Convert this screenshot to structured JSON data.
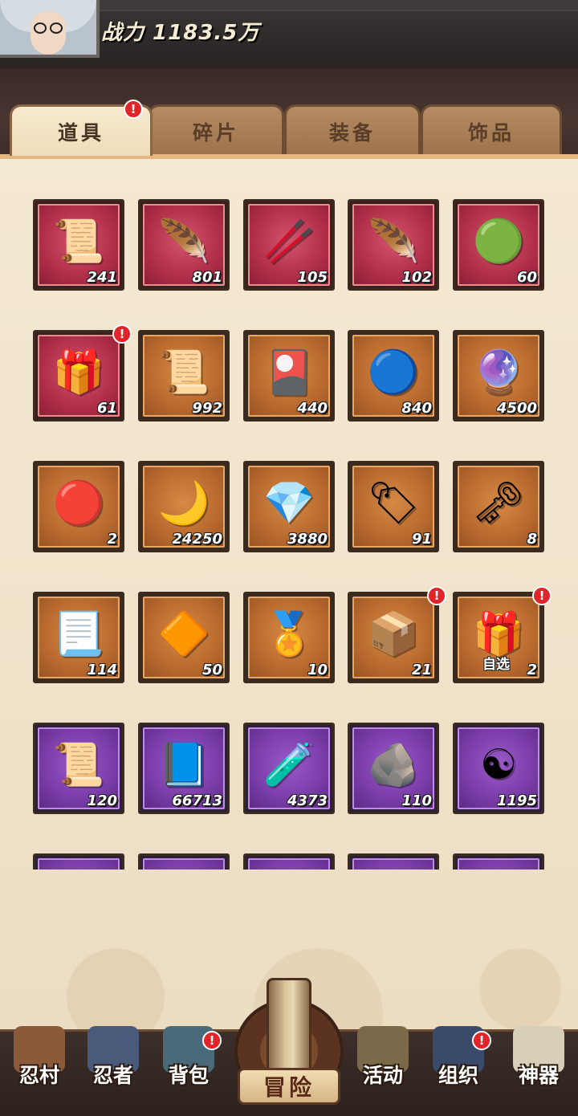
{
  "header": {
    "power_label": "战力 1183.5万",
    "avatar": "silver-haired-ninja-glasses"
  },
  "tabs": [
    {
      "label": "道具",
      "active": true,
      "badge": "!"
    },
    {
      "label": "碎片",
      "active": false
    },
    {
      "label": "装备",
      "active": false
    },
    {
      "label": "饰品",
      "active": false
    }
  ],
  "items": [
    {
      "icon": "scroll-bundle-icon",
      "glyph": "📜",
      "count": "241",
      "rarity": "red"
    },
    {
      "icon": "red-feather-icon",
      "glyph": "🪶",
      "count": "801",
      "rarity": "red"
    },
    {
      "icon": "wooden-stick-icon",
      "glyph": "🥢",
      "count": "105",
      "rarity": "red"
    },
    {
      "icon": "gold-feather-icon",
      "glyph": "🪶",
      "count": "102",
      "rarity": "red"
    },
    {
      "icon": "jade-pendant-icon",
      "glyph": "🟢",
      "count": "60",
      "rarity": "red"
    },
    {
      "icon": "gift-box-icon",
      "glyph": "🎁",
      "count": "61",
      "rarity": "red",
      "badge": "!"
    },
    {
      "icon": "parchment-scroll-icon",
      "glyph": "📜",
      "count": "992",
      "rarity": "brown"
    },
    {
      "icon": "ticket-card-icon",
      "glyph": "🎴",
      "count": "440",
      "rarity": "brown"
    },
    {
      "icon": "blue-orb-icon",
      "glyph": "🔵",
      "count": "840",
      "rarity": "brown"
    },
    {
      "icon": "purple-orb-icon",
      "glyph": "🔮",
      "count": "4500",
      "rarity": "brown"
    },
    {
      "icon": "red-eye-stone-icon",
      "glyph": "🔴",
      "count": "2",
      "rarity": "brown"
    },
    {
      "icon": "blue-moon-icon",
      "glyph": "🌙",
      "count": "24250",
      "rarity": "brown"
    },
    {
      "icon": "purple-crystal-icon",
      "glyph": "💎",
      "count": "3880",
      "rarity": "brown"
    },
    {
      "icon": "fortune-sign-icon",
      "glyph": "🏷",
      "count": "91",
      "rarity": "brown"
    },
    {
      "icon": "iron-key-icon",
      "glyph": "🗝",
      "count": "8",
      "rarity": "brown"
    },
    {
      "icon": "paper-talisman-icon",
      "glyph": "📃",
      "count": "114",
      "rarity": "brown"
    },
    {
      "icon": "amber-gem-icon",
      "glyph": "🔶",
      "count": "50",
      "rarity": "brown"
    },
    {
      "icon": "wisdom-medal-icon",
      "glyph": "🏅",
      "count": "10",
      "rarity": "brown"
    },
    {
      "icon": "gold-chest-icon",
      "glyph": "📦",
      "count": "21",
      "rarity": "brown",
      "badge": "!"
    },
    {
      "icon": "select-chest-icon",
      "glyph": "🎁",
      "count": "2",
      "rarity": "brown",
      "badge": "!",
      "tag": "自选"
    },
    {
      "icon": "blue-scroll-icon",
      "glyph": "📜",
      "count": "120",
      "rarity": "purple"
    },
    {
      "icon": "skill-book-icon",
      "glyph": "📘",
      "count": "66713",
      "rarity": "purple"
    },
    {
      "icon": "red-potion-jar-icon",
      "glyph": "🧪",
      "count": "4373",
      "rarity": "purple"
    },
    {
      "icon": "black-ore-icon",
      "glyph": "🪨",
      "count": "110",
      "rarity": "purple"
    },
    {
      "icon": "yin-yang-icon",
      "glyph": "☯",
      "count": "1195",
      "rarity": "purple"
    },
    {
      "icon": "item-icon",
      "glyph": "",
      "count": "",
      "rarity": "purple"
    },
    {
      "icon": "item-icon",
      "glyph": "",
      "count": "",
      "rarity": "purple"
    },
    {
      "icon": "item-icon",
      "glyph": "",
      "count": "",
      "rarity": "purple"
    },
    {
      "icon": "item-icon",
      "glyph": "",
      "count": "",
      "rarity": "purple"
    },
    {
      "icon": "item-icon",
      "glyph": "",
      "count": "",
      "rarity": "purple"
    }
  ],
  "nav": [
    {
      "label": "忍村",
      "icon": "village-gate-icon"
    },
    {
      "label": "忍者",
      "icon": "ninja-head-icon"
    },
    {
      "label": "背包",
      "icon": "backpack-icon",
      "badge": "!"
    },
    {
      "label": "冒险",
      "icon": "adventure-scroll-icon",
      "center": true
    },
    {
      "label": "活动",
      "icon": "activity-drum-icon"
    },
    {
      "label": "组织",
      "icon": "organization-icon",
      "badge": "!"
    },
    {
      "label": "神器",
      "icon": "artifact-map-icon"
    }
  ],
  "colors": {
    "rarity_red": "#b22f4a",
    "rarity_brown": "#b96a2f",
    "rarity_purple": "#7a3da8",
    "badge": "#e0242a",
    "panel": "#f4e9d3"
  }
}
